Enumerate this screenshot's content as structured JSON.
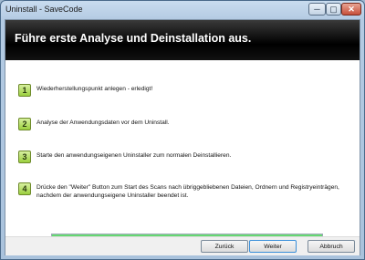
{
  "window": {
    "title": "Uninstall - SaveCode",
    "controls": {
      "minimize": "─",
      "maximize": "▢",
      "close": "✕"
    }
  },
  "banner": {
    "title": "Führe erste Analyse und Deinstallation aus."
  },
  "steps": [
    {
      "number": "1",
      "text": "Wiederherstellungspunkt anlegen - erledigt!"
    },
    {
      "number": "2",
      "text": "Analyse der Anwendungsdaten vor dem Uninstall."
    },
    {
      "number": "3",
      "text": "Starte den anwendungseigenen Uninstaller zum normalen Deinstallieren."
    },
    {
      "number": "4",
      "text_line1": "Drücke den \"Weiter\" Button zum Start des Scans nach übriggebliebenen Dateien, Ordnern und Registryeinträgen,",
      "text_line2": "nachdem der anwendungseigene Uninstaller beendet ist."
    }
  ],
  "progress": {
    "fraction": 1.0,
    "color": "#15c22a"
  },
  "buttons": {
    "back": "Zurück",
    "next": "Weiter",
    "cancel": "Abbruch"
  }
}
